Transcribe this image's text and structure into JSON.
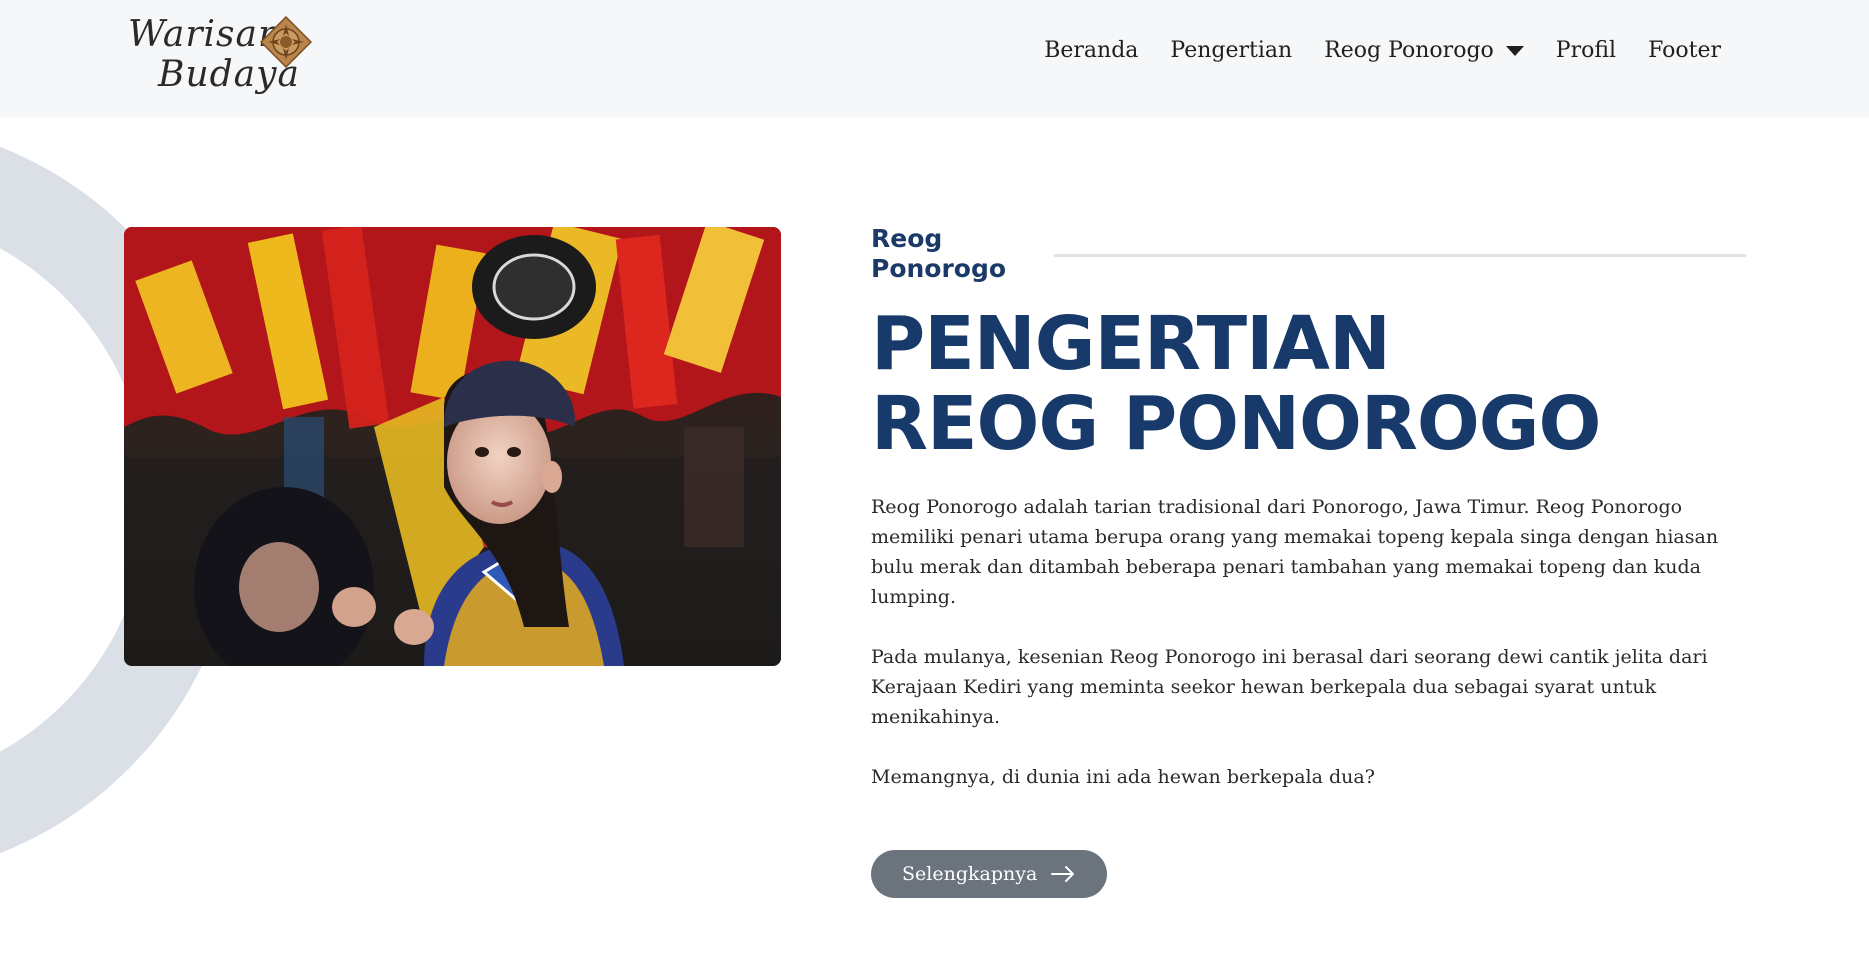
{
  "brand": {
    "line1": "Warisan",
    "line2": "Budaya"
  },
  "nav": {
    "items": [
      {
        "label": "Beranda"
      },
      {
        "label": "Pengertian"
      },
      {
        "label": "Reog Ponorogo"
      },
      {
        "label": "Profil"
      },
      {
        "label": "Footer"
      }
    ]
  },
  "hero": {
    "eyebrow_line1": "Reog",
    "eyebrow_line2": "Ponorogo",
    "title_line1": "PENGERTIAN",
    "title_line2": "REOG PONOROGO",
    "paragraphs": [
      "Reog Ponorogo adalah tarian tradisional dari Ponorogo, Jawa Timur. Reog Ponorogo memiliki penari utama berupa orang yang memakai topeng kepala singa dengan hiasan bulu merak dan ditambah beberapa penari tambahan yang memakai topeng dan kuda lumping.",
      "Pada mulanya, kesenian Reog Ponorogo ini berasal dari seorang dewi cantik jelita dari Kerajaan Kediri yang meminta seekor hewan berkepala dua sebagai syarat untuk menikahinya.",
      "Memangnya, di dunia ini ada hewan berkepala dua?"
    ],
    "button_label": "Selengkapnya"
  },
  "colors": {
    "accent": "#173a6a",
    "button": "#6b737c",
    "navbar_bg": "#f6f7f9",
    "ring": "#dbe0e6"
  },
  "icons": {
    "logo": "ornament-emblem-icon",
    "dropdown": "caret-down-icon",
    "button": "arrow-right-icon"
  }
}
